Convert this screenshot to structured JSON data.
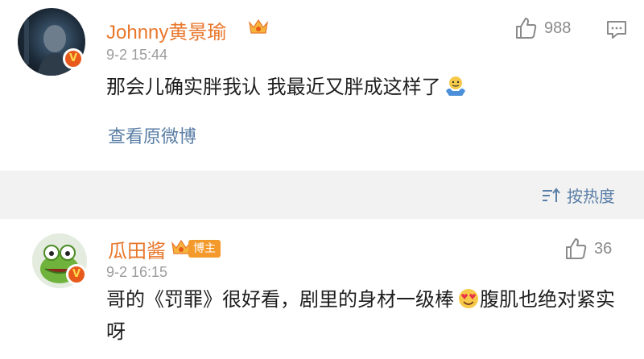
{
  "comments": [
    {
      "username": "Johnny黄景瑜",
      "timestamp": "9-2 15:44",
      "text": "那会儿确实胖我认 我最近又胖成这样了",
      "like_count": "988",
      "view_original": "查看原微博"
    },
    {
      "username": "瓜田酱",
      "host_badge": "博主",
      "timestamp": "9-2 16:15",
      "text": "哥的《罚罪》很好看，剧里的身材一级棒",
      "text_after_emoji": "腹肌也绝对紧实呀",
      "like_count": "36"
    }
  ],
  "sort": {
    "label": "按热度"
  },
  "badge_letter": "V",
  "colors": {
    "username": "#e8772c",
    "link": "#5a7ea6",
    "meta": "#9c9c9c",
    "badge": "#e85a1c",
    "band": "#f2f2f2"
  }
}
